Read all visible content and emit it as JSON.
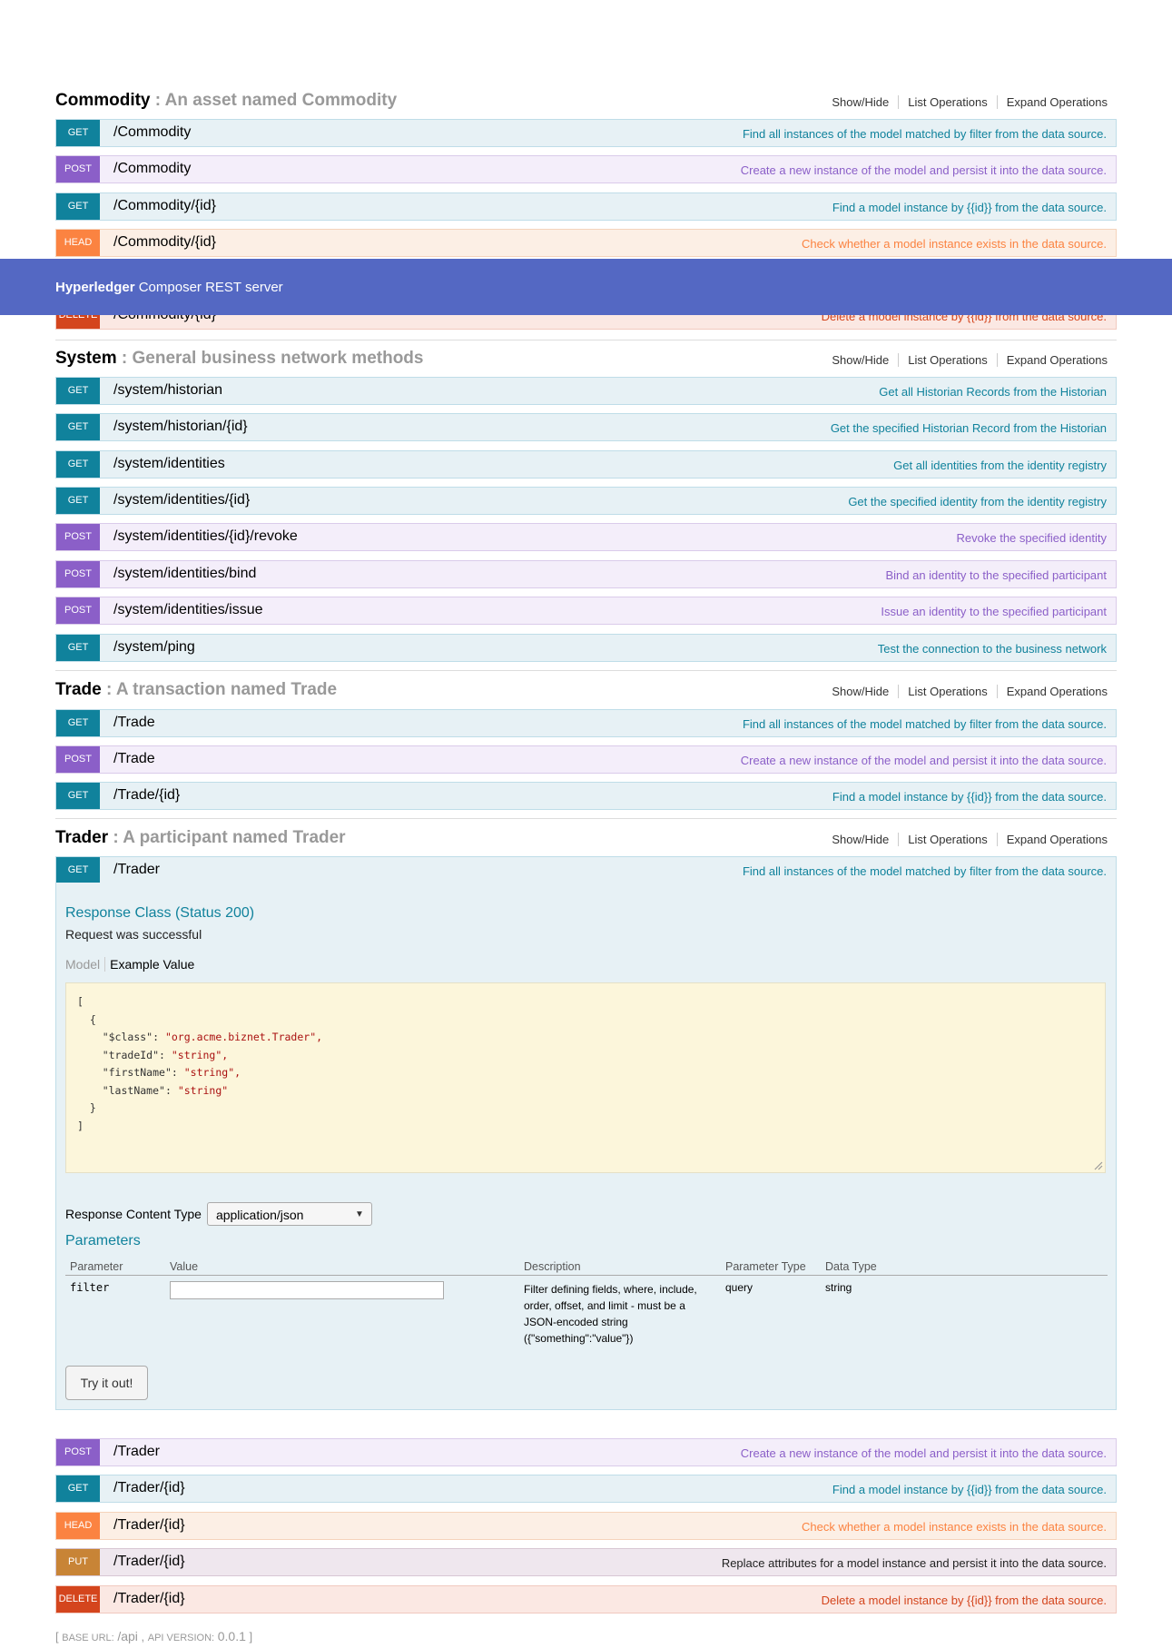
{
  "header": {
    "brand": "Hyperledger",
    "title": "Composer REST server"
  },
  "resource_links": {
    "show_hide": "Show/Hide",
    "list_ops": "List Operations",
    "expand_ops": "Expand Operations"
  },
  "commodity": {
    "name": "Commodity",
    "desc": ": An asset named Commodity",
    "ops": [
      {
        "method": "GET",
        "path": "/Commodity",
        "summary": "Find all instances of the model matched by filter from the data source."
      },
      {
        "method": "POST",
        "path": "/Commodity",
        "summary": "Create a new instance of the model and persist it into the data source."
      },
      {
        "method": "GET",
        "path": "/Commodity/{id}",
        "summary": "Find a model instance by {{id}} from the data source."
      },
      {
        "method": "HEAD",
        "path": "/Commodity/{id}",
        "summary": "Check whether a model instance exists in the data source."
      },
      {
        "method": "DELETE",
        "path": "/Commodity/{id}",
        "summary": "Delete a model instance by {{id}} from the data source."
      }
    ]
  },
  "system": {
    "name": "System",
    "desc": ": General business network methods",
    "ops": [
      {
        "method": "GET",
        "path": "/system/historian",
        "summary": "Get all Historian Records from the Historian"
      },
      {
        "method": "GET",
        "path": "/system/historian/{id}",
        "summary": "Get the specified Historian Record from the Historian"
      },
      {
        "method": "GET",
        "path": "/system/identities",
        "summary": "Get all identities from the identity registry"
      },
      {
        "method": "GET",
        "path": "/system/identities/{id}",
        "summary": "Get the specified identity from the identity registry"
      },
      {
        "method": "POST",
        "path": "/system/identities/{id}/revoke",
        "summary": "Revoke the specified identity"
      },
      {
        "method": "POST",
        "path": "/system/identities/bind",
        "summary": "Bind an identity to the specified participant"
      },
      {
        "method": "POST",
        "path": "/system/identities/issue",
        "summary": "Issue an identity to the specified participant"
      },
      {
        "method": "GET",
        "path": "/system/ping",
        "summary": "Test the connection to the business network"
      }
    ]
  },
  "trade": {
    "name": "Trade",
    "desc": ": A transaction named Trade",
    "ops": [
      {
        "method": "GET",
        "path": "/Trade",
        "summary": "Find all instances of the model matched by filter from the data source."
      },
      {
        "method": "POST",
        "path": "/Trade",
        "summary": "Create a new instance of the model and persist it into the data source."
      },
      {
        "method": "GET",
        "path": "/Trade/{id}",
        "summary": "Find a model instance by {{id}} from the data source."
      }
    ]
  },
  "trader": {
    "name": "Trader",
    "desc": ": A participant named Trader",
    "ops": [
      {
        "method": "GET",
        "path": "/Trader",
        "summary": "Find all instances of the model matched by filter from the data source."
      },
      {
        "method": "POST",
        "path": "/Trader",
        "summary": "Create a new instance of the model and persist it into the data source."
      },
      {
        "method": "GET",
        "path": "/Trader/{id}",
        "summary": "Find a model instance by {{id}} from the data source."
      },
      {
        "method": "HEAD",
        "path": "/Trader/{id}",
        "summary": "Check whether a model instance exists in the data source."
      },
      {
        "method": "PUT",
        "path": "/Trader/{id}",
        "summary": "Replace attributes for a model instance and persist it into the data source."
      },
      {
        "method": "DELETE",
        "path": "/Trader/{id}",
        "summary": "Delete a model instance by {{id}} from the data source."
      }
    ]
  },
  "expanded": {
    "response_class": "Response Class (Status 200)",
    "request_ok": "Request was successful",
    "tab_model": "Model",
    "tab_example": "Example Value",
    "example": {
      "open_bracket": "[",
      "open_brace": "{",
      "close_brace": "}",
      "close_bracket": "]",
      "fields": [
        {
          "key": "\"$class\"",
          "value": "\"org.acme.biznet.Trader\","
        },
        {
          "key": "\"tradeId\"",
          "value": "\"string\","
        },
        {
          "key": "\"firstName\"",
          "value": "\"string\","
        },
        {
          "key": "\"lastName\"",
          "value": "\"string\""
        }
      ]
    },
    "response_content_type_label": "Response Content Type",
    "response_content_type": "application/json",
    "parameters_heading": "Parameters",
    "columns": {
      "parameter": "Parameter",
      "value": "Value",
      "description": "Description",
      "param_type": "Parameter Type",
      "data_type": "Data Type"
    },
    "param": {
      "name": "filter",
      "value": "",
      "description": "Filter defining fields, where, include, order, offset, and limit - must be a JSON-encoded string ({\"something\":\"value\"})",
      "param_type": "query",
      "data_type": "string"
    },
    "try_button": "Try it out!"
  },
  "footer": {
    "open": "[ ",
    "base_label": "BASE URL:",
    "base_url": "/api",
    "sep": " , ",
    "version_label": "API VERSION:",
    "version": "0.0.1",
    "close": " ]"
  }
}
